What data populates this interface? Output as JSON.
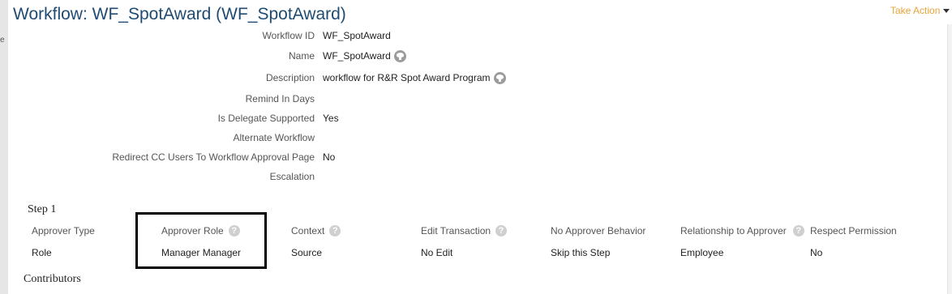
{
  "page": {
    "title": "Workflow: WF_SpotAward (WF_SpotAward)",
    "take_action": "Take Action"
  },
  "details": [
    {
      "label": "Workflow ID",
      "value": "WF_SpotAward",
      "has_globe": false
    },
    {
      "label": "Name",
      "value": "WF_SpotAward",
      "has_globe": true
    },
    {
      "label": "Description",
      "value": "workflow for R&R Spot Award Program",
      "has_globe": true
    },
    {
      "label": "Remind In Days",
      "value": "",
      "has_globe": false
    },
    {
      "label": "Is Delegate Supported",
      "value": "Yes",
      "has_globe": false
    },
    {
      "label": "Alternate Workflow",
      "value": "",
      "has_globe": false
    },
    {
      "label": "Redirect CC Users To Workflow Approval Page",
      "value": "No",
      "has_globe": false
    },
    {
      "label": "Escalation",
      "value": "",
      "has_globe": false
    }
  ],
  "step": {
    "heading": "Step 1",
    "columns": [
      {
        "header": "Approver Type",
        "value": "Role",
        "has_help": false
      },
      {
        "header": "Approver Role",
        "value": "Manager Manager",
        "has_help": true
      },
      {
        "header": "Context",
        "value": "Source",
        "has_help": true
      },
      {
        "header": "Edit Transaction",
        "value": "No Edit",
        "has_help": true
      },
      {
        "header": "No Approver Behavior",
        "value": "Skip this Step",
        "has_help": false
      },
      {
        "header": "Relationship to Approver",
        "value": "Employee",
        "has_help": true
      },
      {
        "header": "Respect Permission",
        "value": "No",
        "has_help": false
      }
    ]
  },
  "contributors": {
    "heading": "Contributors"
  },
  "icons": {
    "help": "question-circle-icon",
    "globe": "globe-icon",
    "caret": "caret-down-icon"
  },
  "colors": {
    "title": "#1f4b73",
    "take_action": "#e8a33b",
    "highlight_border": "#000000"
  }
}
